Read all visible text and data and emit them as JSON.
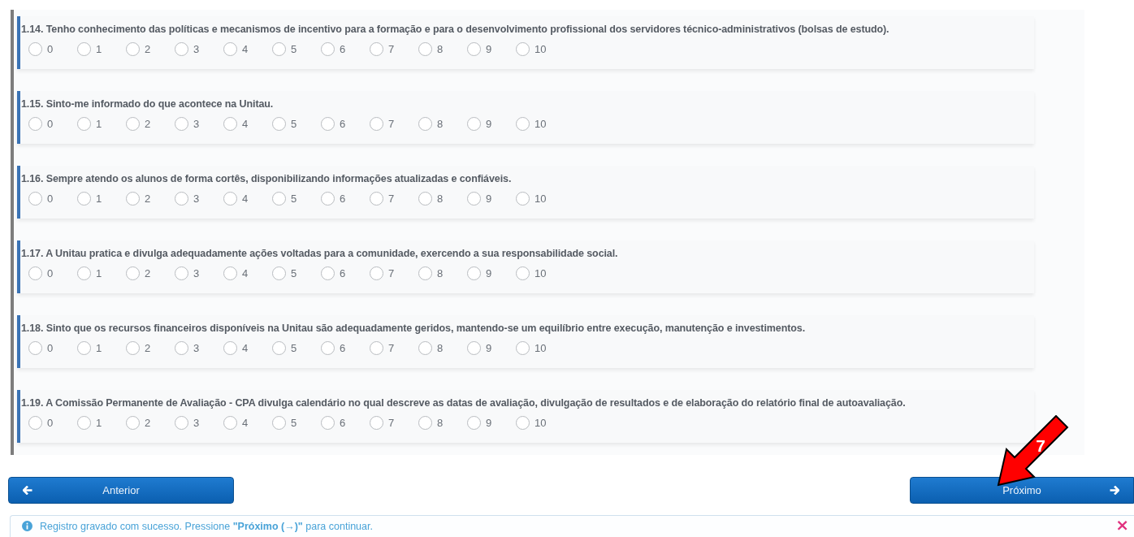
{
  "questions": [
    {
      "text": "1.14. Tenho conhecimento das políticas e mecanismos de incentivo para a formação e para o desenvolvimento profissional dos servidores técnico-administrativos (bolsas de estudo).",
      "options": [
        {
          "label": "0",
          "selected": false
        },
        {
          "label": "1",
          "selected": false
        },
        {
          "label": "2",
          "selected": false
        },
        {
          "label": "3",
          "selected": false
        },
        {
          "label": "4",
          "selected": false
        },
        {
          "label": "5",
          "selected": false
        },
        {
          "label": "6",
          "selected": false
        },
        {
          "label": "7",
          "selected": false
        },
        {
          "label": "8",
          "selected": false
        },
        {
          "label": "9",
          "selected": false
        },
        {
          "label": "10",
          "selected": false
        }
      ]
    },
    {
      "text": "1.15. Sinto-me informado do que acontece na Unitau.",
      "options": [
        {
          "label": "0",
          "selected": false
        },
        {
          "label": "1",
          "selected": false
        },
        {
          "label": "2",
          "selected": false
        },
        {
          "label": "3",
          "selected": false
        },
        {
          "label": "4",
          "selected": false
        },
        {
          "label": "5",
          "selected": false
        },
        {
          "label": "6",
          "selected": false
        },
        {
          "label": "7",
          "selected": false
        },
        {
          "label": "8",
          "selected": false
        },
        {
          "label": "9",
          "selected": false
        },
        {
          "label": "10",
          "selected": false
        }
      ]
    },
    {
      "text": "1.16. Sempre atendo os alunos de forma cortês, disponibilizando informações atualizadas e confiáveis.",
      "options": [
        {
          "label": "0",
          "selected": false
        },
        {
          "label": "1",
          "selected": false
        },
        {
          "label": "2",
          "selected": false
        },
        {
          "label": "3",
          "selected": false
        },
        {
          "label": "4",
          "selected": false
        },
        {
          "label": "5",
          "selected": false
        },
        {
          "label": "6",
          "selected": false
        },
        {
          "label": "7",
          "selected": false
        },
        {
          "label": "8",
          "selected": false
        },
        {
          "label": "9",
          "selected": false
        },
        {
          "label": "10",
          "selected": false
        }
      ]
    },
    {
      "text": "1.17. A Unitau pratica e divulga adequadamente ações voltadas para a comunidade, exercendo a sua responsabilidade social.",
      "options": [
        {
          "label": "0",
          "selected": false
        },
        {
          "label": "1",
          "selected": false
        },
        {
          "label": "2",
          "selected": false
        },
        {
          "label": "3",
          "selected": false
        },
        {
          "label": "4",
          "selected": false
        },
        {
          "label": "5",
          "selected": false
        },
        {
          "label": "6",
          "selected": false
        },
        {
          "label": "7",
          "selected": false
        },
        {
          "label": "8",
          "selected": false
        },
        {
          "label": "9",
          "selected": false
        },
        {
          "label": "10",
          "selected": false
        }
      ]
    },
    {
      "text": "1.18. Sinto que os recursos financeiros disponíveis na Unitau são adequadamente geridos, mantendo-se um equilíbrio entre execução, manutenção e investimentos.",
      "options": [
        {
          "label": "0",
          "selected": false
        },
        {
          "label": "1",
          "selected": false
        },
        {
          "label": "2",
          "selected": false
        },
        {
          "label": "3",
          "selected": false
        },
        {
          "label": "4",
          "selected": false
        },
        {
          "label": "5",
          "selected": false
        },
        {
          "label": "6",
          "selected": false
        },
        {
          "label": "7",
          "selected": false
        },
        {
          "label": "8",
          "selected": false
        },
        {
          "label": "9",
          "selected": false
        },
        {
          "label": "10",
          "selected": false
        }
      ]
    },
    {
      "text": "1.19. A Comissão Permanente de Avaliação - CPA divulga calendário no qual descreve as datas de avaliação, divulgação de resultados e de elaboração do relatório final de autoavaliação.",
      "options": [
        {
          "label": "0",
          "selected": false
        },
        {
          "label": "1",
          "selected": false
        },
        {
          "label": "2",
          "selected": false
        },
        {
          "label": "3",
          "selected": false
        },
        {
          "label": "4",
          "selected": false
        },
        {
          "label": "5",
          "selected": false
        },
        {
          "label": "6",
          "selected": false
        },
        {
          "label": "7",
          "selected": false
        },
        {
          "label": "8",
          "selected": false
        },
        {
          "label": "9",
          "selected": false
        },
        {
          "label": "10",
          "selected": false
        }
      ]
    }
  ],
  "navigation": [
    {
      "label": "Anterior",
      "kind": "previous"
    },
    {
      "label": "Próximo",
      "kind": "next"
    }
  ],
  "alert": {
    "text": "Registro gravado com sucesso. Pressione **\"Próximo (→)\"** para continuar.",
    "close": "×"
  },
  "annotation": {
    "label": "7"
  }
}
